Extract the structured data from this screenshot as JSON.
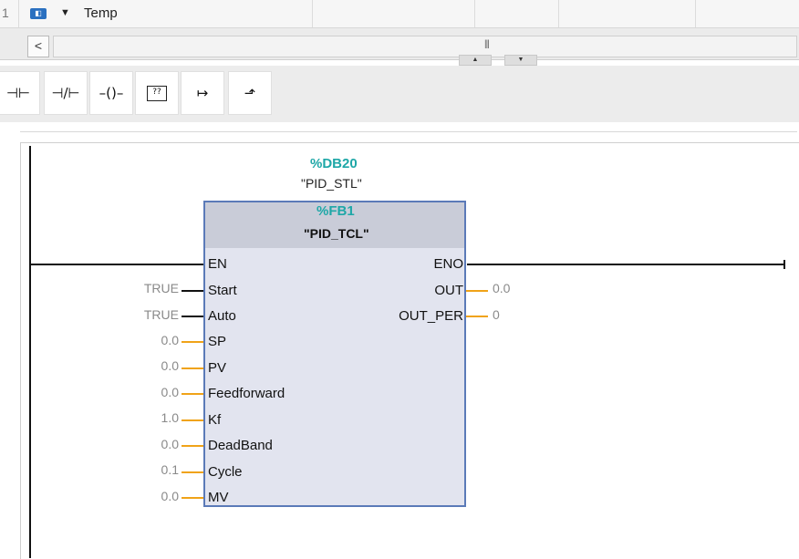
{
  "interface_row": {
    "number": "1",
    "name": "Temp",
    "section_icon": "db-section-icon"
  },
  "lad_toolbar": [
    {
      "icon": "nc-contact",
      "glyph": "⊣⊢"
    },
    {
      "icon": "no-contact",
      "glyph": "⊣/⊢"
    },
    {
      "icon": "coil",
      "glyph": "–()–"
    },
    {
      "icon": "empty-box",
      "glyph": "??"
    },
    {
      "icon": "open-branch",
      "glyph": "↦"
    },
    {
      "icon": "close-branch",
      "glyph": "⬏"
    }
  ],
  "block": {
    "instance_db_number": "%DB20",
    "instance_db_name": "\"PID_STL\"",
    "fb_number": "%FB1",
    "fb_name": "\"PID_TCL\"",
    "inputs": [
      {
        "pin": "EN",
        "value": ""
      },
      {
        "pin": "Start",
        "value": "TRUE"
      },
      {
        "pin": "Auto",
        "value": "TRUE"
      },
      {
        "pin": "SP",
        "value": "0.0"
      },
      {
        "pin": "PV",
        "value": "0.0"
      },
      {
        "pin": "Feedforward",
        "value": "0.0"
      },
      {
        "pin": "Kf",
        "value": "1.0"
      },
      {
        "pin": "DeadBand",
        "value": "0.0"
      },
      {
        "pin": "Cycle",
        "value": "0.1"
      },
      {
        "pin": "MV",
        "value": "0.0"
      }
    ],
    "outputs": [
      {
        "pin": "ENO",
        "value": ""
      },
      {
        "pin": "OUT",
        "value": "0.0"
      },
      {
        "pin": "OUT_PER",
        "value": "0"
      }
    ]
  },
  "colors": {
    "wire_orange": "#f0a318",
    "block_border": "#5b7ab8",
    "db_teal": "#1ea7a7"
  }
}
